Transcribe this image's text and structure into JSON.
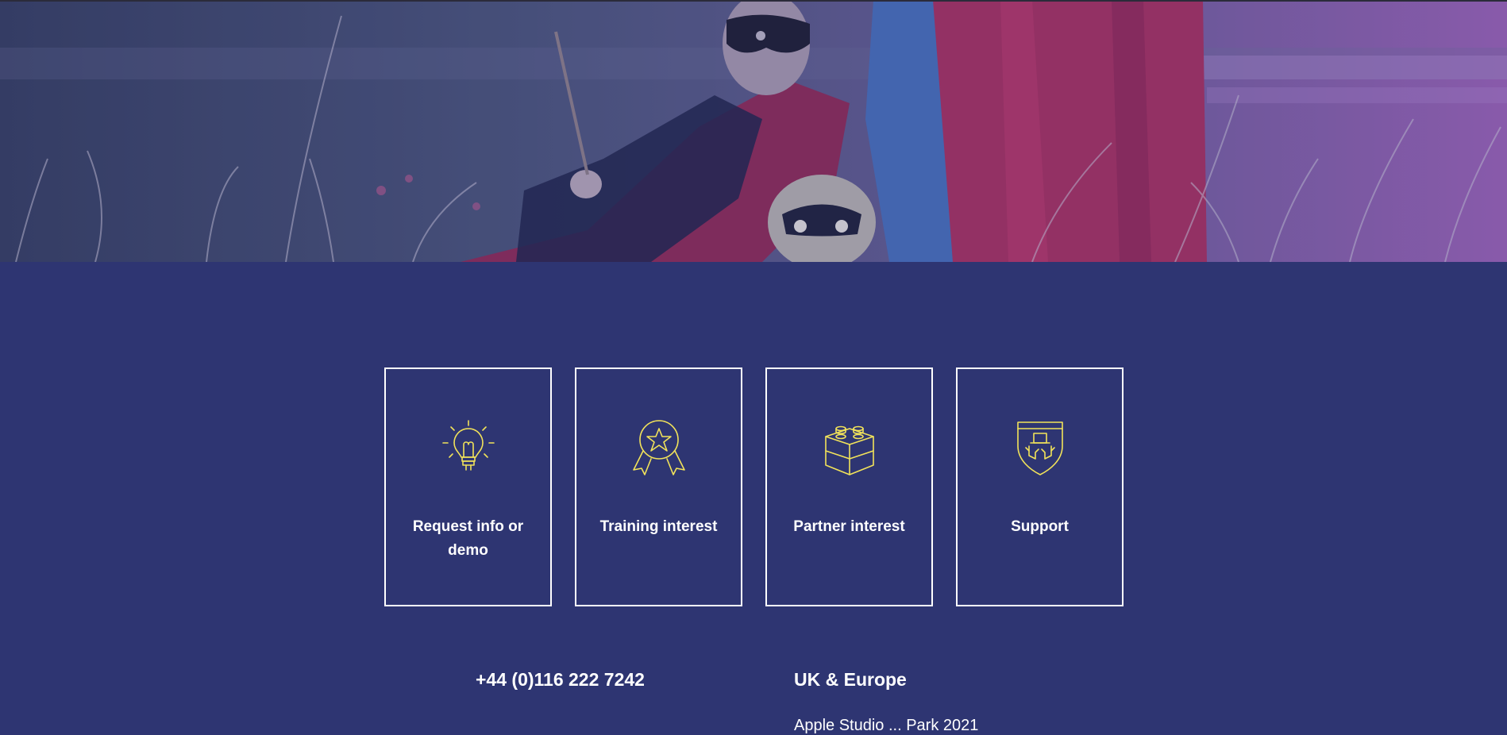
{
  "hero": {
    "image_icon": "hero-photo-children-in-capes"
  },
  "cards": [
    {
      "label": "Request info or demo",
      "icon": "lightbulb-icon"
    },
    {
      "label": "Training interest",
      "icon": "award-ribbon-icon"
    },
    {
      "label": "Partner interest",
      "icon": "building-block-icon"
    },
    {
      "label": "Support",
      "icon": "shield-hands-icon"
    }
  ],
  "contact": {
    "phone": "+44 (0)116 222 7242",
    "region": "UK & Europe",
    "address_partial": "Apple Studio ... Park 2021"
  },
  "colors": {
    "background": "#2e3572",
    "card_border": "#ffffff",
    "icon_stroke": "#f2e35a"
  }
}
